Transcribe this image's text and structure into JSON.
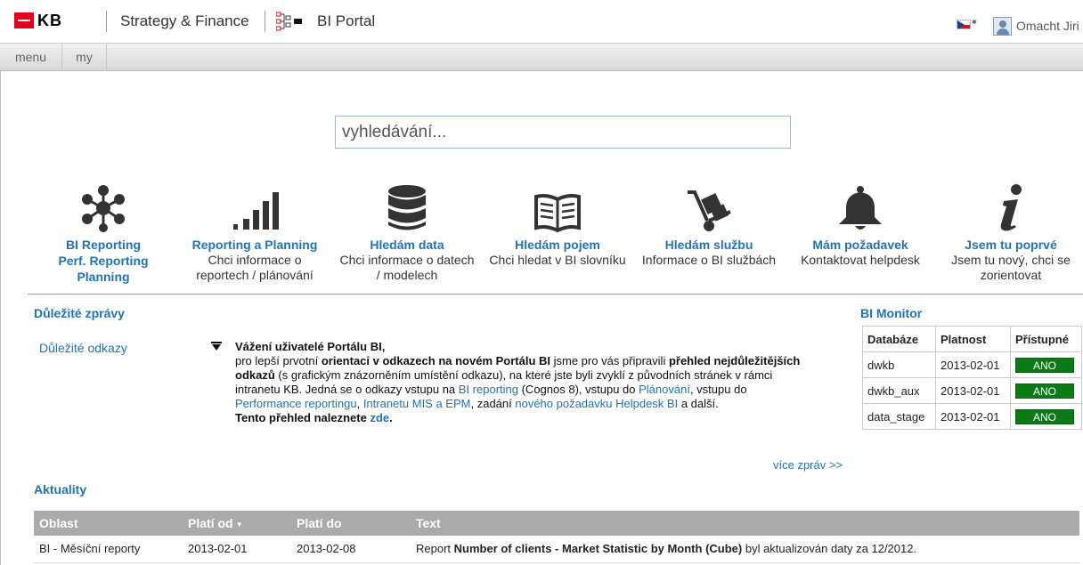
{
  "header": {
    "logo_text": "KB",
    "brand": "Strategy & Finance",
    "portal_title": "BI Portal",
    "user_name": "Omacht Jiri"
  },
  "nav": {
    "menu": "menu",
    "my": "my"
  },
  "search": {
    "placeholder": "vyhledávání..."
  },
  "tiles": [
    {
      "icon": "network-icon",
      "title_lines": [
        "BI Reporting",
        "Perf. Reporting",
        "Planning"
      ],
      "desc_lines": []
    },
    {
      "icon": "bar-chart-icon",
      "title_lines": [
        "Reporting a Planning"
      ],
      "desc_lines": [
        "Chci informace o",
        "reportech / plánování"
      ]
    },
    {
      "icon": "database-icon",
      "title_lines": [
        "Hledám data"
      ],
      "desc_lines": [
        "Chci informace o datech",
        "/ modelech"
      ]
    },
    {
      "icon": "book-icon",
      "title_lines": [
        "Hledám pojem"
      ],
      "desc_lines": [
        "Chci hledat v BI slovníku"
      ]
    },
    {
      "icon": "hand-truck-icon",
      "title_lines": [
        "Hledám službu"
      ],
      "desc_lines": [
        "Informace o BI službách"
      ]
    },
    {
      "icon": "bell-icon",
      "title_lines": [
        "Mám požadavek"
      ],
      "desc_lines": [
        "Kontaktovat helpdesk"
      ]
    },
    {
      "icon": "info-icon",
      "title_lines": [
        "Jsem tu poprvé"
      ],
      "desc_lines": [
        "Jsem tu nový, chci se",
        "zorientovat"
      ]
    }
  ],
  "important": {
    "title": "Důležité zprávy",
    "left_link": "Důležité odkazy",
    "message": {
      "greeting": "Vážení uživatelé Portálu BI,",
      "p1": "pro lepší prvotní ",
      "p1b": "orientaci v odkazech na novém Portálu BI",
      "p2": " jsme pro vás připravili ",
      "p2b": "přehled nejdůležitějších odkazů",
      "p3": " (s grafickým znázorněním umístění odkazu), na které jste byli zvyklí z původních stránek v rámci intranetu KB. Jedná se o odkazy vstupu na ",
      "l1": "BI reporting",
      "p4": " (Cognos 8), vstupu do ",
      "l2": "Plánování",
      "p5": ", vstupu do ",
      "l3": "Performance reportingu",
      "p6": ", ",
      "l4": "Intranetu MIS a EPM",
      "p7": ", zadání ",
      "l5": "nového požadavku Helpdesk BI",
      "p8": " a další.",
      "final": "Tento přehled naleznete ",
      "final_link": "zde",
      "final_end": "."
    },
    "more": "více zpráv >>"
  },
  "monitor": {
    "title": "BI Monitor",
    "headers": [
      "Databáze",
      "Platnost",
      "Přístupné"
    ],
    "rows": [
      {
        "db": "dwkb",
        "date": "2013-02-01",
        "status": "ANO"
      },
      {
        "db": "dwkb_aux",
        "date": "2013-02-01",
        "status": "ANO"
      },
      {
        "db": "data_stage",
        "date": "2013-02-01",
        "status": "ANO"
      }
    ],
    "status_color": "#0c7a17"
  },
  "news": {
    "title": "Aktuality",
    "headers": [
      "Oblast",
      "Platí od",
      "Platí do",
      "Text"
    ],
    "rows": [
      {
        "area": "BI - Měsíční reporty",
        "from": "2013-02-01",
        "to": "2013-02-08",
        "text_pre": "Report ",
        "text_bold": "Number of clients - Market Statistic by Month (Cube)",
        "text_post": " byl aktualizován daty za 12/2012."
      }
    ]
  },
  "colors": {
    "brand_red": "#e2001a",
    "link_blue": "#1e73b9"
  }
}
